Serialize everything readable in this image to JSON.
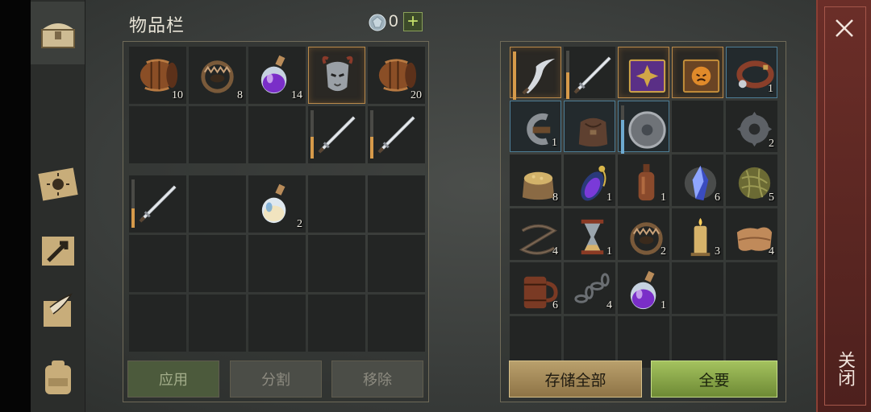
{
  "header": {
    "title": "物品栏",
    "gem_count": "0",
    "plus_label": "+"
  },
  "tabs": [
    {
      "icon": "chest-icon",
      "active": true
    },
    {
      "icon": "sun-book-icon",
      "active": false
    },
    {
      "icon": "map-arrow-icon",
      "active": false
    },
    {
      "icon": "scroll-quill-icon",
      "active": false
    },
    {
      "icon": "backpack-icon",
      "active": false
    }
  ],
  "inventory": {
    "slots": [
      {
        "icon": "barrel-icon",
        "qty": "10"
      },
      {
        "icon": "bear-trap-icon",
        "qty": "8"
      },
      {
        "icon": "purple-potion-icon",
        "qty": "14"
      },
      {
        "icon": "horned-helmet-icon",
        "qty": "",
        "selected": true
      },
      {
        "icon": "barrel-icon",
        "qty": "20"
      },
      {
        "icon": "",
        "qty": ""
      },
      {
        "icon": "",
        "qty": ""
      },
      {
        "icon": "",
        "qty": ""
      },
      {
        "icon": "sword-icon",
        "qty": "",
        "durability": 0.45
      },
      {
        "icon": "sword-icon",
        "qty": "",
        "durability": 0.45
      }
    ]
  },
  "backpack": {
    "slots": [
      {
        "icon": "sword-icon",
        "qty": "",
        "durability": 0.4
      },
      {
        "icon": "",
        "qty": ""
      },
      {
        "icon": "potion-icon",
        "qty": "2"
      },
      {
        "icon": "",
        "qty": ""
      },
      {
        "icon": "",
        "qty": ""
      },
      {
        "icon": "",
        "qty": ""
      },
      {
        "icon": "",
        "qty": ""
      },
      {
        "icon": "",
        "qty": ""
      },
      {
        "icon": "",
        "qty": ""
      },
      {
        "icon": "",
        "qty": ""
      },
      {
        "icon": "",
        "qty": ""
      },
      {
        "icon": "",
        "qty": ""
      },
      {
        "icon": "",
        "qty": ""
      },
      {
        "icon": "",
        "qty": ""
      },
      {
        "icon": "",
        "qty": ""
      }
    ]
  },
  "storage": {
    "slots": [
      {
        "icon": "curved-blade-icon",
        "qty": "",
        "durability": 1.0,
        "selected": true
      },
      {
        "icon": "sword-icon",
        "qty": "",
        "durability": 0.55
      },
      {
        "icon": "purple-tome-icon",
        "qty": "",
        "selected": true
      },
      {
        "icon": "mask-book-icon",
        "qty": "",
        "selected": true
      },
      {
        "icon": "collar-icon",
        "qty": "1",
        "blue": true
      },
      {
        "icon": "iron-hook-icon",
        "qty": "1",
        "blue": true
      },
      {
        "icon": "leather-bag-icon",
        "qty": "",
        "blue": true
      },
      {
        "icon": "round-shield-icon",
        "qty": "",
        "blue": true,
        "durability": 0.7,
        "durability_color": "blue"
      },
      {
        "icon": "",
        "qty": ""
      },
      {
        "icon": "gear-icon",
        "qty": "2"
      },
      {
        "icon": "grain-sack-icon",
        "qty": "8"
      },
      {
        "icon": "mana-potion-icon",
        "qty": "1"
      },
      {
        "icon": "bottle-icon",
        "qty": "1"
      },
      {
        "icon": "crystal-icon",
        "qty": "6"
      },
      {
        "icon": "fiber-ball-icon",
        "qty": "5"
      },
      {
        "icon": "rope-icon",
        "qty": "4"
      },
      {
        "icon": "hourglass-icon",
        "qty": "1"
      },
      {
        "icon": "bear-trap-icon",
        "qty": "2"
      },
      {
        "icon": "candle-icon",
        "qty": "3"
      },
      {
        "icon": "cloth-icon",
        "qty": "4"
      },
      {
        "icon": "mug-icon",
        "qty": "6"
      },
      {
        "icon": "chain-icon",
        "qty": "4"
      },
      {
        "icon": "purple-potion-icon",
        "qty": "1"
      },
      {
        "icon": "",
        "qty": ""
      },
      {
        "icon": "",
        "qty": ""
      },
      {
        "icon": "",
        "qty": ""
      },
      {
        "icon": "",
        "qty": ""
      },
      {
        "icon": "",
        "qty": ""
      },
      {
        "icon": "",
        "qty": ""
      },
      {
        "icon": "",
        "qty": ""
      }
    ]
  },
  "buttons": {
    "apply": "应用",
    "split": "分割",
    "remove": "移除",
    "store_all": "存储全部",
    "take_all": "全要"
  },
  "close": {
    "label": "关闭"
  },
  "colors": {
    "accent_gold": "#d69a4a",
    "accent_blue": "#6eaad0",
    "close_bg": "#6b2e28",
    "take_all_green": "#a4c25e"
  }
}
